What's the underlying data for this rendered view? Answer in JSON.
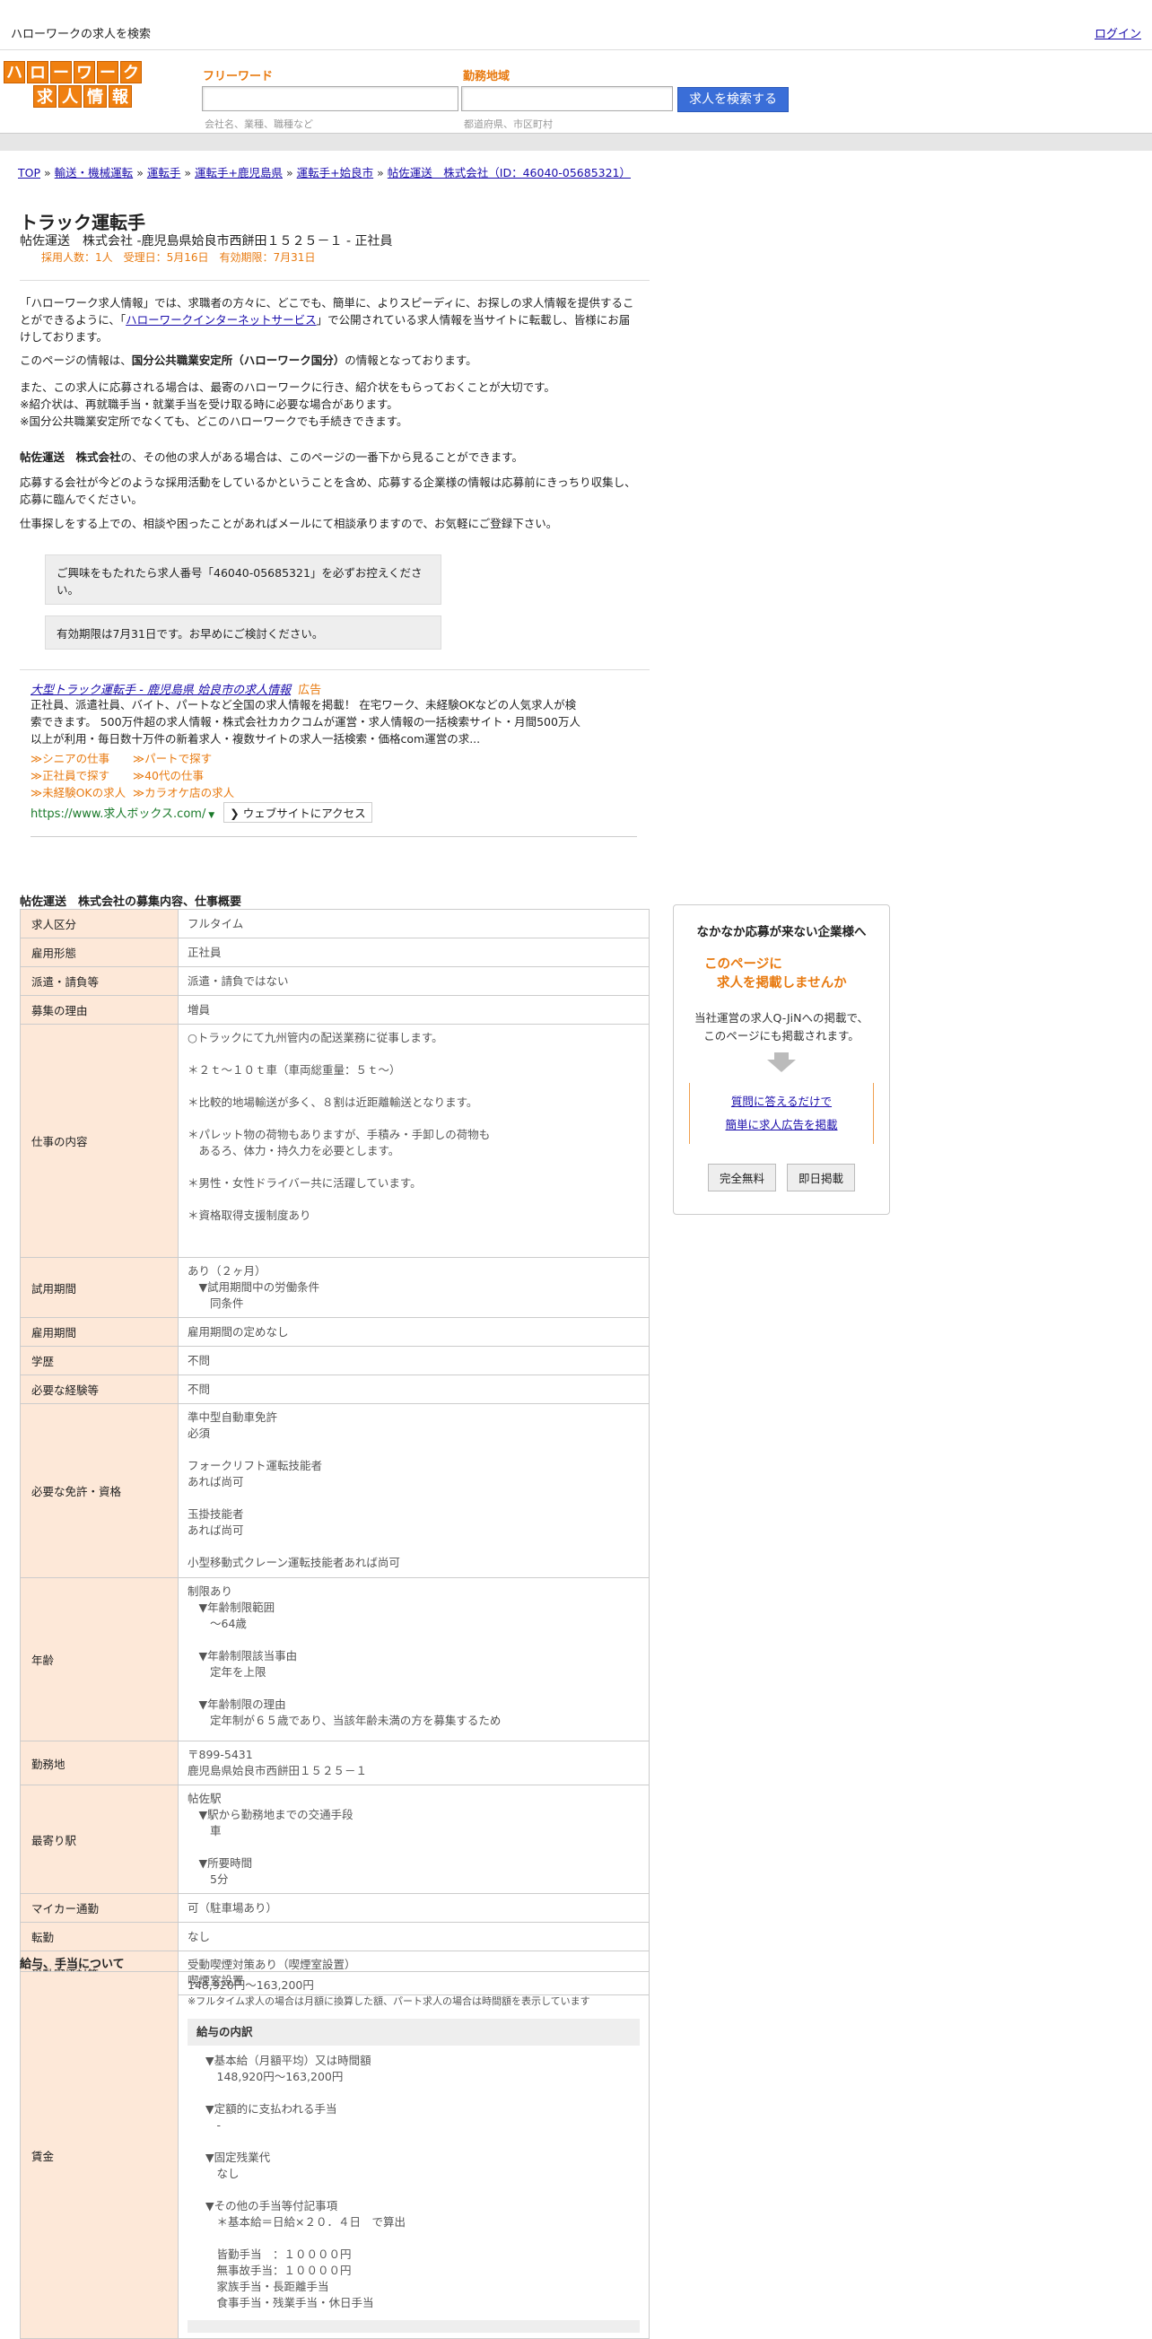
{
  "topbar": {
    "site_title": "ハローワークの求人を検索",
    "login": "ログイン"
  },
  "logo": {
    "row1": [
      "ハ",
      "ロ",
      "ー",
      "ワ",
      "ー",
      "ク"
    ],
    "row2": [
      "求",
      "人",
      "情",
      "報"
    ]
  },
  "search": {
    "freeword_label": "フリーワード",
    "freeword_placeholder": "会社名、業種、職種など",
    "area_label": "勤務地域",
    "area_placeholder": "都道府県、市区町村",
    "button": "求人を検索する"
  },
  "breadcrumb": [
    "TOP",
    "輸送・機械運転",
    "運転手",
    "運転手+鹿児島県",
    "運転手+姶良市",
    "帖佐運送　株式会社（ID：46040-05685321）"
  ],
  "job": {
    "title": "トラック運転手",
    "subtitle": "帖佐運送　株式会社 -鹿児島県姶良市西餅田１５２５－１ - 正社員",
    "meta": "採用人数：1人　受理日：5月16日　有効期限：7月31日"
  },
  "intro": {
    "p1_a": "「ハローワーク求人情報」では、求職者の方々に、どこでも、簡単に、よりスピーディに、お探しの求人情報を提供することができるように、「",
    "p1_link": "ハローワークインターネットサービス",
    "p1_b": "」で公開されている求人情報を当サイトに転載し、皆様にお届けしております。",
    "p2_a": "このページの情報は、",
    "p2_bold": "国分公共職業安定所（ハローワーク国分）",
    "p2_b": "の情報となっております。",
    "p3": "また、この求人に応募される場合は、最寄のハローワークに行き、紹介状をもらっておくことが大切です。",
    "p4": "※紹介状は、再就職手当・就業手当を受け取る時に必要な場合があります。",
    "p5": "※国分公共職業安定所でなくても、どこのハローワークでも手続きできます。",
    "p6_bold": "帖佐運送　株式会社",
    "p6": "の、その他の求人がある場合は、このページの一番下から見ることができます。",
    "p7": "応募する会社が今どのような採用活動をしているかということを含め、応募する企業様の情報は応募前にきっちり収集し、応募に臨んでください。",
    "p8": "仕事探しをする上での、相談や困ったことがあればメールにて相談承りますので、お気軽にご登録下さい。"
  },
  "notes": {
    "n1": "ご興味をもたれたら求人番号「46040-05685321」を必ずお控えください。",
    "n2": "有効期限は7月31日です。お早めにご検討ください。"
  },
  "ad": {
    "title": "大型トラック運転手 - 鹿児島県 姶良市の求人情報",
    "tag": "広告",
    "body": "正社員、派遣社員、バイト、パートなど全国の求人情報を掲載！ 在宅ワーク、未経験OKなどの人気求人が検索できます。 500万件超の求人情報・株式会社カカクコムが運営・求人情報の一括検索サイト・月間500万人以上が利用・毎日数十万件の新着求人・複数サイトの求人一括検索・価格com運営の求...",
    "links": [
      [
        "≫シニアの仕事",
        "≫パートで探す"
      ],
      [
        "≫正社員で探す",
        "≫40代の仕事"
      ],
      [
        "≫未経験OKの求人",
        "≫カラオケ店の求人"
      ]
    ],
    "url": "https://www.求人ボックス.com/",
    "visit": "❯ ウェブサイトにアクセス"
  },
  "section1_title": "帖佐運送　株式会社の募集内容、仕事概要",
  "details": [
    {
      "label": "求人区分",
      "value": "フルタイム"
    },
    {
      "label": "雇用形態",
      "value": "正社員"
    },
    {
      "label": "派遣・請負等",
      "value": "派遣・請負ではない"
    },
    {
      "label": "募集の理由",
      "value": "増員"
    },
    {
      "label": "仕事の内容",
      "value": "○トラックにて九州管内の配送業務に従事します。\n\n＊２ｔ～１０ｔ車（車両総重量：５ｔ～）\n\n＊比較的地場輸送が多く、８割は近距離輸送となります。\n\n＊パレット物の荷物もありますが、手積み・手卸しの荷物も\n　あるろ、体力・持久力を必要とします。\n\n＊男性・女性ドライバー共に活躍しています。\n\n＊資格取得支援制度あり"
    },
    {
      "label": "試用期間",
      "value": "あり（２ヶ月）\n　▼試用期間中の労働条件\n　　同条件"
    },
    {
      "label": "雇用期間",
      "value": "雇用期間の定めなし"
    },
    {
      "label": "学歴",
      "value": "不問"
    },
    {
      "label": "必要な経験等",
      "value": "不問"
    },
    {
      "label": "必要な免許・資格",
      "value": "準中型自動車免許\n必須\n\nフォークリフト運転技能者\nあれば尚可\n\n玉掛技能者\nあれば尚可\n\n小型移動式クレーン運転技能者あれば尚可"
    },
    {
      "label": "年齢",
      "value": "制限あり\n　▼年齢制限範囲\n　　～64歳\n\n　▼年齢制限該当事由\n　　定年を上限\n\n　▼年齢制限の理由\n　　定年制が６５歳であり、当該年齢未満の方を募集するため"
    },
    {
      "label": "勤務地",
      "value": "〒899-5431\n鹿児島県姶良市西餅田１５２５－１"
    },
    {
      "label": "最寄り駅",
      "value": "帖佐駅\n　▼駅から勤務地までの交通手段\n　　車\n\n　▼所要時間\n　　5分"
    },
    {
      "label": "マイカー通勤",
      "value": "可（駐車場あり）"
    },
    {
      "label": "転勤",
      "value": "なし"
    },
    {
      "label": "受動喫煙対策",
      "value": "受動喫煙対策あり（喫煙室設置）\n喫煙室設置"
    }
  ],
  "section2_title": "給与、手当について",
  "pay": {
    "label": "賃金",
    "range": "148,920円〜163,200円",
    "note": "※フルタイム求人の場合は月額に換算した額、パート求人の場合は時間額を表示しています",
    "breakdown_head": "給与の内訳",
    "breakdown": "▼基本給（月額平均）又は時間額\n　148,920円〜163,200円\n\n▼定額的に支払われる手当\n　-\n\n▼固定残業代\n　なし\n\n▼その他の手当等付記事項\n　＊基本給＝日給×２０．４日　で算出\n\n　皆勤手当　：１００００円\n　無事故手当：１００００円\n　家族手当・長距離手当\n　食事手当・残業手当・休日手当"
  },
  "side": {
    "title": "なかなか応募が来ない企業様へ",
    "catch1": "このページに",
    "catch2": "求人を掲載しませんか",
    "desc1": "当社運営の求人Q-JiNへの掲載で、",
    "desc2": "このページにも掲載されます。",
    "link1": "質問に答えるだけで",
    "link2": "簡単に求人広告を掲載",
    "btn1": "完全無料",
    "btn2": "即日掲載"
  }
}
